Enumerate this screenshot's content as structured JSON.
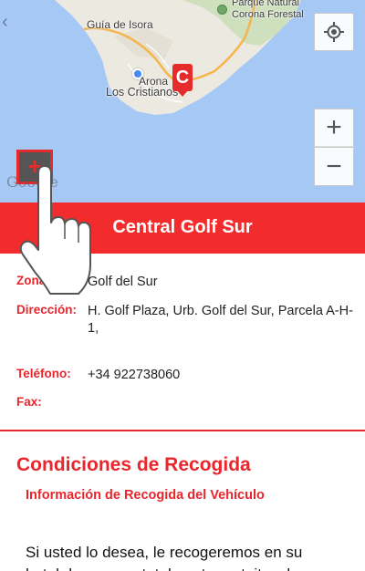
{
  "map": {
    "labels": {
      "guia": "Guía de Isora",
      "parque": "Parque Natural",
      "corona": "Corona Forestal",
      "arona": "Arona",
      "cristianos": "Los Cristianos"
    },
    "watermark": "Google",
    "marker_letter": "C",
    "back_glyph": "‹",
    "zoom_in": "+",
    "zoom_out": "−",
    "expand": "+"
  },
  "header": {
    "title": "Central Golf Sur"
  },
  "info": {
    "zona_label": "Zona:",
    "zona_value": "Golf del Sur",
    "direccion_label": "Dirección:",
    "direccion_value": "H. Golf Plaza, Urb. Golf del Sur, Parcela A-H-1,",
    "telefono_label": "Teléfono:",
    "telefono_value": "+34 922738060",
    "fax_label": "Fax:",
    "fax_value": ""
  },
  "conditions": {
    "title": "Condiciones de Recogida",
    "subtitle": "Información de Recogida del Vehículo",
    "text": "Si usted lo desea, le recogeremos en su hotel de manera totalmente gratuita y le"
  },
  "colors": {
    "accent": "#f22c2c",
    "sea": "#a6c8f4"
  }
}
